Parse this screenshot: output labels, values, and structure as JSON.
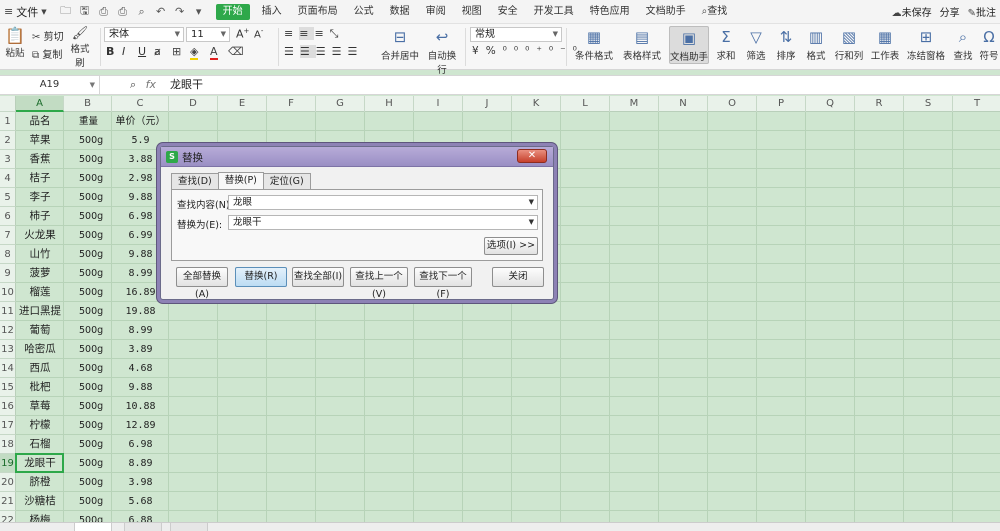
{
  "menubar": {
    "file_label": "文件",
    "tabs": [
      "开始",
      "插入",
      "页面布局",
      "公式",
      "数据",
      "审阅",
      "视图",
      "安全",
      "开发工具",
      "特色应用",
      "文档助手"
    ],
    "search_label": "查找",
    "unsaved_label": "未保存",
    "share_label": "分享",
    "comment_label": "批注"
  },
  "ribbon": {
    "paste_label": "粘贴",
    "cut_label": "剪切",
    "copy_label": "复制",
    "format_painter_label": "格式刷",
    "font_name": "宋体",
    "font_size": "11",
    "number_format": "常规",
    "merge_label": "合并居中",
    "wrap_label": "自动换行",
    "cond_format_label": "条件格式",
    "table_style_label": "表格样式",
    "doc_assistant_label": "文档助手",
    "sum_label": "求和",
    "filter_label": "筛选",
    "sort_label": "排序",
    "format_label": "格式",
    "rowcol_label": "行和列",
    "sheet_label": "工作表",
    "freeze_label": "冻结窗格",
    "find_label": "查找",
    "symbol_label": "符号"
  },
  "formula_bar": {
    "cell_ref": "A19",
    "fx": "fx",
    "content": "龙眼干"
  },
  "columns": [
    "A",
    "B",
    "C",
    "D",
    "E",
    "F",
    "G",
    "H",
    "I",
    "J",
    "K",
    "L",
    "M",
    "N",
    "O",
    "P",
    "Q",
    "R",
    "S",
    "T"
  ],
  "rows": [
    {
      "num": "1",
      "a": "品名",
      "b": "重量",
      "c": "单价（元）"
    },
    {
      "num": "2",
      "a": "苹果",
      "b": "500g",
      "c": "5.9"
    },
    {
      "num": "3",
      "a": "香蕉",
      "b": "500g",
      "c": "3.88"
    },
    {
      "num": "4",
      "a": "桔子",
      "b": "500g",
      "c": "2.98"
    },
    {
      "num": "5",
      "a": "李子",
      "b": "500g",
      "c": "9.88"
    },
    {
      "num": "6",
      "a": "柿子",
      "b": "500g",
      "c": "6.98"
    },
    {
      "num": "7",
      "a": "火龙果",
      "b": "500g",
      "c": "6.99"
    },
    {
      "num": "8",
      "a": "山竹",
      "b": "500g",
      "c": "9.88"
    },
    {
      "num": "9",
      "a": "菠萝",
      "b": "500g",
      "c": "8.99"
    },
    {
      "num": "10",
      "a": "榴莲",
      "b": "500g",
      "c": "16.89"
    },
    {
      "num": "11",
      "a": "进口黑提",
      "b": "500g",
      "c": "19.88"
    },
    {
      "num": "12",
      "a": "葡萄",
      "b": "500g",
      "c": "8.99"
    },
    {
      "num": "13",
      "a": "哈密瓜",
      "b": "500g",
      "c": "3.89"
    },
    {
      "num": "14",
      "a": "西瓜",
      "b": "500g",
      "c": "4.68"
    },
    {
      "num": "15",
      "a": "枇杷",
      "b": "500g",
      "c": "9.88"
    },
    {
      "num": "16",
      "a": "草莓",
      "b": "500g",
      "c": "10.88"
    },
    {
      "num": "17",
      "a": "柠檬",
      "b": "500g",
      "c": "12.89"
    },
    {
      "num": "18",
      "a": "石榴",
      "b": "500g",
      "c": "6.98"
    },
    {
      "num": "19",
      "a": "龙眼干",
      "b": "500g",
      "c": "8.89"
    },
    {
      "num": "20",
      "a": "脐橙",
      "b": "500g",
      "c": "3.98"
    },
    {
      "num": "21",
      "a": "沙糖桔",
      "b": "500g",
      "c": "5.68"
    },
    {
      "num": "22",
      "a": "杨梅",
      "b": "500g",
      "c": "6.88"
    }
  ],
  "dialog": {
    "title": "替换",
    "tabs": [
      "查找(D)",
      "替换(P)",
      "定位(G)"
    ],
    "find_label": "查找内容(N):",
    "find_value": "龙眼",
    "replace_label": "替换为(E):",
    "replace_value": "龙眼干",
    "options_button": "选项(I) >>",
    "buttons": [
      "全部替换(A)",
      "替换(R)",
      "查找全部(I)",
      "查找上一个(V)",
      "查找下一个(F)",
      "关闭"
    ],
    "close_glyph": "✕"
  }
}
